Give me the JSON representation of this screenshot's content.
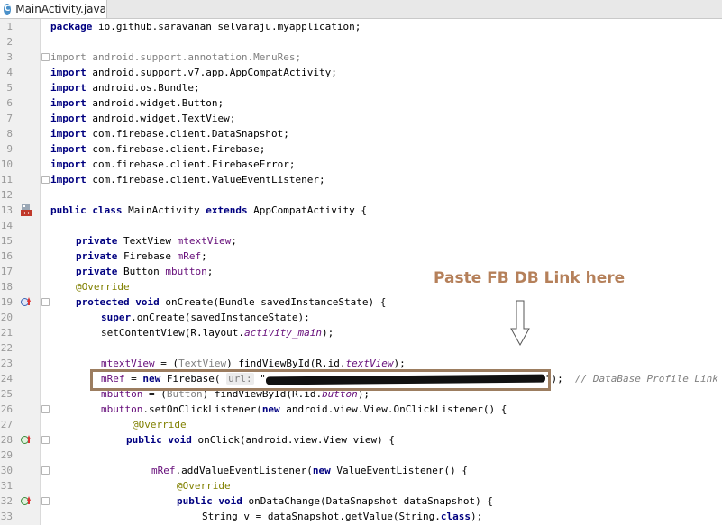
{
  "tab": {
    "icon_letter": "C",
    "title": "MainActivity.java"
  },
  "annotation": {
    "text": "Paste FB DB Link here"
  },
  "lines": [
    {
      "n": "1"
    },
    {
      "n": "2"
    },
    {
      "n": "3"
    },
    {
      "n": "4"
    },
    {
      "n": "5"
    },
    {
      "n": "6"
    },
    {
      "n": "7"
    },
    {
      "n": "8"
    },
    {
      "n": "9"
    },
    {
      "n": "10"
    },
    {
      "n": "11"
    },
    {
      "n": "12"
    },
    {
      "n": "13"
    },
    {
      "n": "14"
    },
    {
      "n": "15"
    },
    {
      "n": "16"
    },
    {
      "n": "17"
    },
    {
      "n": "18"
    },
    {
      "n": "19"
    },
    {
      "n": "20"
    },
    {
      "n": "21"
    },
    {
      "n": "22"
    },
    {
      "n": "23"
    },
    {
      "n": "24"
    },
    {
      "n": "25"
    },
    {
      "n": "26"
    },
    {
      "n": "27"
    },
    {
      "n": "28"
    },
    {
      "n": "29"
    },
    {
      "n": "30"
    },
    {
      "n": "31"
    },
    {
      "n": "32"
    },
    {
      "n": "33"
    }
  ],
  "code": {
    "l1_kw": "package",
    "l1_rest": " io.github.saravanan_selvaraju.myapplication;",
    "import_kw": "import",
    "l3": " android.support.annotation.MenuRes;",
    "l4": " android.support.v7.app.AppCompatActivity;",
    "l5": " android.os.Bundle;",
    "l6": " android.widget.Button;",
    "l7": " android.widget.TextView;",
    "l8": " com.firebase.client.DataSnapshot;",
    "l9": " com.firebase.client.Firebase;",
    "l10": " com.firebase.client.FirebaseError;",
    "l11": " com.firebase.client.ValueEventListener;",
    "l13_kw1": "public class",
    "l13_mid": " MainActivity ",
    "l13_kw2": "extends",
    "l13_rest": " AppCompatActivity {",
    "private_kw": "private",
    "l15_type": " TextView ",
    "l15_field": "mtextView",
    "l16_type": " Firebase ",
    "l16_field": "mRef",
    "l17_type": " Button ",
    "l17_field": "mbutton",
    "semi": ";",
    "override": "@Override",
    "l19_kw": "protected void",
    "l19_rest": " onCreate(Bundle savedInstanceState) {",
    "l20_kw": "super",
    "l20_rest": ".onCreate(savedInstanceState);",
    "l21_a": "setContentView(R.layout.",
    "l21_b": "activity_main",
    "l21_c": ");",
    "l23_field": "mtextView",
    "l23_a": " = (",
    "l23_cast": "TextView",
    "l23_b": ") findViewById(R.id.",
    "l23_c": "textView",
    "l23_d": ");",
    "l24_field": "mRef",
    "l24_a": " = ",
    "l24_kw": "new",
    "l24_b": " Firebase(",
    "l24_hint": "url:",
    "l24_quote": " \"",
    "l24_end": "\");",
    "l24_comment": "// DataBase Profile Link",
    "l25_field": "mbutton",
    "l25_a": " = (",
    "l25_cast": "Button",
    "l25_b": ") findViewById(R.id.",
    "l25_c": "button",
    "l25_d": ");",
    "l26_field": "mbutton",
    "l26_a": ".setOnClickListener(",
    "l26_kw": "new",
    "l26_b": " android.view.View.OnClickListener() {",
    "l28_kw": "public void",
    "l28_rest": " onClick(android.view.View view) {",
    "l30_field": "mRef",
    "l30_a": ".addValueEventListener(",
    "l30_kw": "new",
    "l30_b": " ValueEventListener() {",
    "l32_kw": "public void",
    "l32_rest": " onDataChange(DataSnapshot dataSnapshot) {",
    "l33_a": "String v = dataSnapshot.getValue(String.",
    "l33_kw": "class",
    "l33_b": ");"
  }
}
